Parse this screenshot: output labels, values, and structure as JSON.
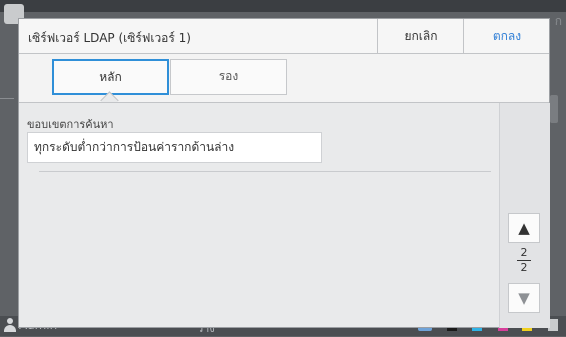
{
  "dialog": {
    "title": "เซิร์ฟเวอร์ LDAP (เซิร์ฟเวอร์ 1)",
    "cancel_label": "ยกเลิก",
    "ok_label": "ตกลง"
  },
  "tabs": [
    {
      "label": "หลัก",
      "selected": true
    },
    {
      "label": "รอง",
      "selected": false
    }
  ],
  "search_scope": {
    "label": "ขอบเขตการค้นหา",
    "value": "ทุกระดับต่ำกว่าการป้อนค่ารากด้านล่าง"
  },
  "pagination": {
    "current": "2",
    "total": "2",
    "up_glyph": "▲",
    "down_glyph": "▼"
  },
  "background": {
    "ghost_text": "ก",
    "user": "Admin",
    "status": "ว่าง",
    "toner": [
      {
        "name": "K",
        "color": "#1a1a1a"
      },
      {
        "name": "C",
        "color": "#2fb3e6"
      },
      {
        "name": "M",
        "color": "#d63f9a"
      },
      {
        "name": "Y",
        "color": "#f0d020"
      },
      {
        "name": "G",
        "color": "#c9cbcd"
      }
    ]
  },
  "colors": {
    "accent": "#2f8fd8",
    "ok_text": "#2f7ed6"
  }
}
